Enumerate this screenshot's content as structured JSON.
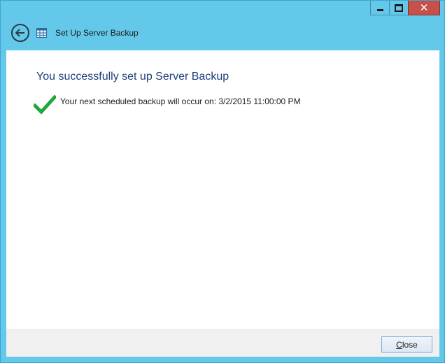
{
  "window": {
    "title": "Set Up Server Backup",
    "accent_color": "#64c8ea",
    "caption_buttons": {
      "minimize_icon": "minimize-icon",
      "maximize_icon": "maximize-icon",
      "close_glyph": "✕"
    }
  },
  "header": {
    "back_icon": "back-arrow-icon",
    "app_icon": "server-backup-icon",
    "title": "Set Up Server Backup"
  },
  "main": {
    "heading": "You successfully set up Server Backup",
    "status_icon": "checkmark-icon",
    "status_text": "Your next scheduled backup will occur on: 3/2/2015 11:00:00 PM"
  },
  "footer": {
    "close_accel": "C",
    "close_rest": "lose"
  }
}
